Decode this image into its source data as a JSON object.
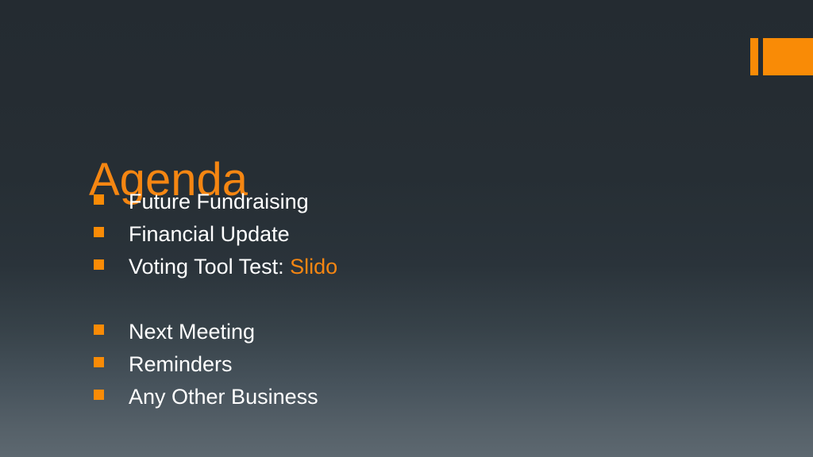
{
  "slide": {
    "title": "Agenda",
    "colors": {
      "accent_orange": "#F98B06",
      "title_orange": "#F58612",
      "text_white": "#FFFFFF",
      "bg_top": "#242B31",
      "bg_bottom": "#5D6870"
    },
    "decoration": {
      "thin_bar": "orange-vertical-bar",
      "wide_bar": "orange-rectangle"
    },
    "bullets": [
      {
        "text": "Future Fundraising",
        "accent": ""
      },
      {
        "text": "Financial Update",
        "accent": ""
      },
      {
        "text": "Voting Tool Test: ",
        "accent": "Slido"
      },
      {
        "text": "",
        "accent": ""
      },
      {
        "text": "Next Meeting",
        "accent": ""
      },
      {
        "text": "Reminders",
        "accent": ""
      },
      {
        "text": "Any Other Business",
        "accent": ""
      }
    ]
  }
}
